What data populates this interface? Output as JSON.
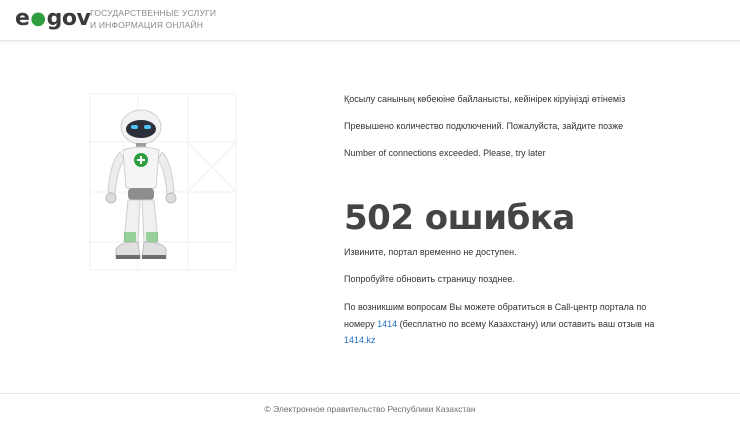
{
  "header": {
    "logo": {
      "prefix": "e",
      "suffix": "gov"
    },
    "tagline_line1": "ГОСУДАРСТВЕННЫЕ УСЛУГИ",
    "tagline_line2": "И ИНФОРМАЦИЯ ОНЛАЙН"
  },
  "messages": {
    "kazakh": "Қосылу санының көбеюіне байланысты, кейінірек кіруіңізді өтінеміз",
    "russian": "Превышено количество подключений. Пожалуйста, зайдите позже",
    "english": "Number of connections exceeded. Please, try later"
  },
  "error": {
    "title": "502 ошибка",
    "unavailable": "Извините, портал временно не доступен.",
    "refresh": "Попробуйте обновить страницу позднее."
  },
  "contact": {
    "text1": "По возникшим вопросам Вы можете обратиться в Call-центр портала по номеру ",
    "phone_link": "1414",
    "text2": " (бесплатно по всему Казахстану) или оставить ваш отзыв на ",
    "site_link": "1414.kz"
  },
  "footer": {
    "copyright": "© Электронное правительство Республики Казахстан"
  },
  "colors": {
    "brand_green": "#2e9e3e",
    "link_blue": "#1f6fbf"
  }
}
